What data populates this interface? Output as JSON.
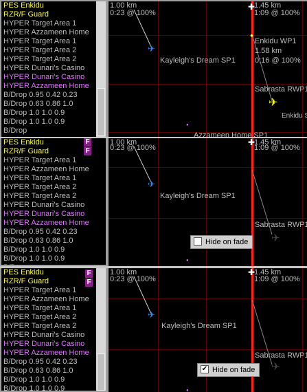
{
  "list_items": [
    {
      "label": "PES Enkidu",
      "color": "yellow"
    },
    {
      "label": "RZR/F Guard",
      "color": "yellow"
    },
    {
      "label": "HYPER Target Area 1",
      "color": "grey"
    },
    {
      "label": "HYPER Azzameen Home",
      "color": "grey"
    },
    {
      "label": "HYPER Target Area 1",
      "color": "grey"
    },
    {
      "label": "HYPER Target Area 2",
      "color": "grey"
    },
    {
      "label": "HYPER Target Area 2",
      "color": "grey"
    },
    {
      "label": "HYPER Dunari's Casino",
      "color": "grey"
    },
    {
      "label": "HYPER Dunari's Casino",
      "color": "magenta"
    },
    {
      "label": "HYPER Azzameen Home",
      "color": "magenta"
    },
    {
      "label": "B/Drop 0.95 0.42 0.23",
      "color": "grey"
    },
    {
      "label": "B/Drop 0.63 0.86 1.0",
      "color": "grey"
    },
    {
      "label": "B/Drop 1.0 1.0 0.9",
      "color": "grey"
    },
    {
      "label": "B/Drop 1.0 1.0 0.9",
      "color": "grey"
    },
    {
      "label": "B/Drop",
      "color": "grey"
    }
  ],
  "flag_badge": "F",
  "map": {
    "scale_left_top": "1.00 km",
    "time_left": "0:23 @ 100%",
    "scale_right_top": "1.45 km",
    "time_right": "1:09 @ 100%",
    "waypoint_label": "Enkidu WP1",
    "waypoint_dist": "1.58 km",
    "waypoint_time": "0:16 @ 100%",
    "sp_label": "Kayleigh's Dream SP1",
    "overlap_label": "Sabrasta RWP1",
    "home_label": "Azzameen Home SP1",
    "enkidu_label": "Enkidu S"
  },
  "hide_on_fade_label": "Hide on fade",
  "hide_on_fade_checked": [
    false,
    true
  ],
  "colors": {
    "yellow": "#ffff33",
    "grey": "#bdbdbd",
    "magenta": "#e070ff"
  }
}
